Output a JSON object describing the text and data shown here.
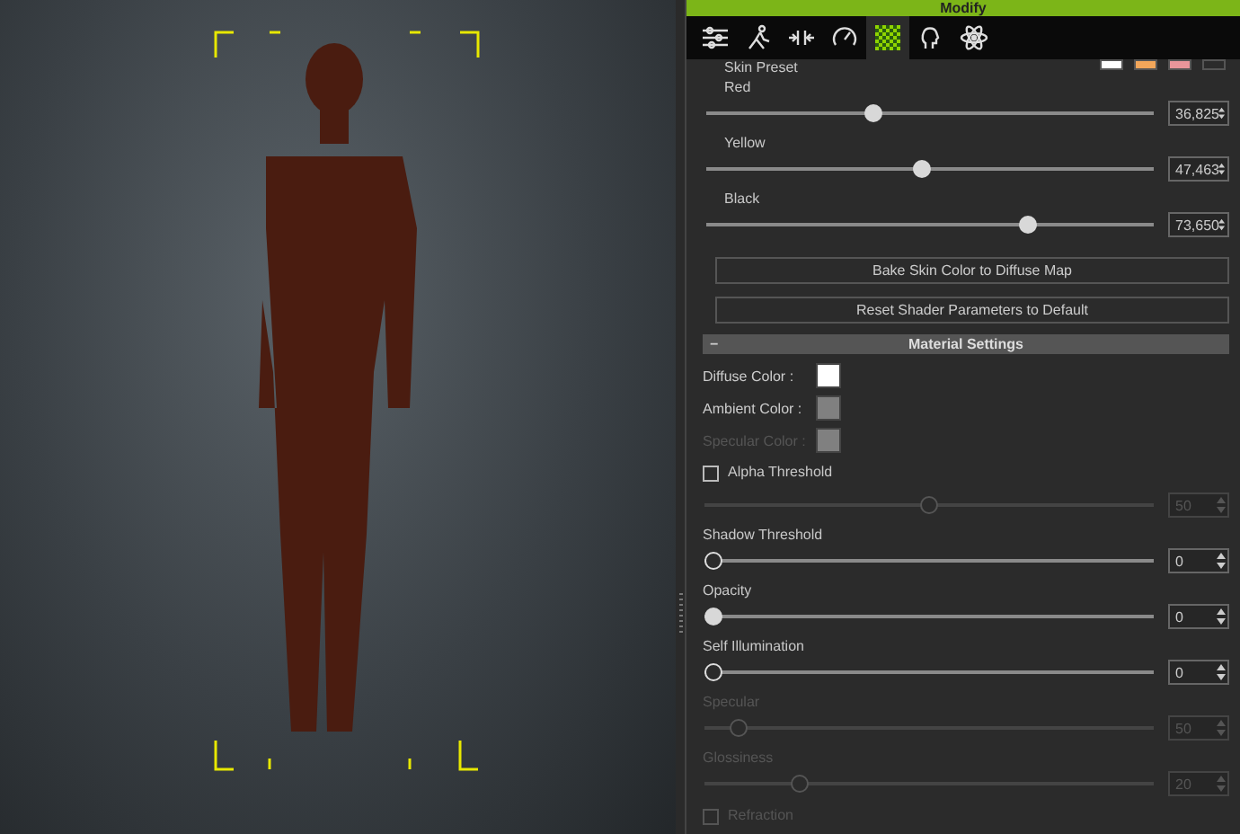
{
  "panel": {
    "title": "Modify",
    "tabs": [
      {
        "selected": false
      },
      {
        "selected": false
      },
      {
        "selected": false
      },
      {
        "selected": false
      },
      {
        "selected": true
      },
      {
        "selected": false
      },
      {
        "selected": false
      }
    ],
    "skin_preset": {
      "label": "Skin Preset",
      "swatches": [
        {
          "color": "#ffffff"
        },
        {
          "color": "#f2a65a"
        },
        {
          "color": "#e8959a"
        },
        {
          "color": "#2b2b2b"
        }
      ]
    },
    "color_sliders": [
      {
        "label": "Red",
        "level": 0.37,
        "value": "36,825"
      },
      {
        "label": "Yellow",
        "level": 0.48,
        "value": "47,463"
      },
      {
        "label": "Black",
        "level": 0.73,
        "value": "73,650"
      }
    ],
    "buttons": [
      "Bake Skin Color to Diffuse Map",
      "Reset Shader Parameters to Default"
    ],
    "material_settings": {
      "title": "Material Settings",
      "toggle": "−",
      "colors": [
        {
          "label": "Diffuse Color :",
          "color": "#ffffff",
          "disabled": false
        },
        {
          "label": "Ambient Color :",
          "color": "#808080",
          "disabled": false
        },
        {
          "label": "Specular Color :",
          "color": "#808080",
          "disabled": true
        }
      ],
      "rows": [
        {
          "kind": "checkbox",
          "label": "Alpha Threshold",
          "checked": false,
          "disabled": false
        },
        {
          "kind": "slider",
          "level": 0.5,
          "value": "50",
          "disabled": true
        },
        {
          "kind": "slider",
          "label": "Shadow Threshold",
          "level": 0,
          "value": "0",
          "disabled": false
        },
        {
          "kind": "slider",
          "label": "Opacity",
          "level": 0,
          "value": "0",
          "disabled": false
        },
        {
          "kind": "slider",
          "label": "Self Illumination",
          "level": 0,
          "value": "0",
          "disabled": false
        },
        {
          "kind": "slider",
          "label": "Specular",
          "level": 0.06,
          "value": "50",
          "disabled": true
        },
        {
          "kind": "slider",
          "label": "Glossiness",
          "level": 0.2,
          "value": "20",
          "disabled": true
        },
        {
          "kind": "checkbox",
          "label": "Refraction",
          "checked": false,
          "disabled": true
        }
      ]
    }
  }
}
